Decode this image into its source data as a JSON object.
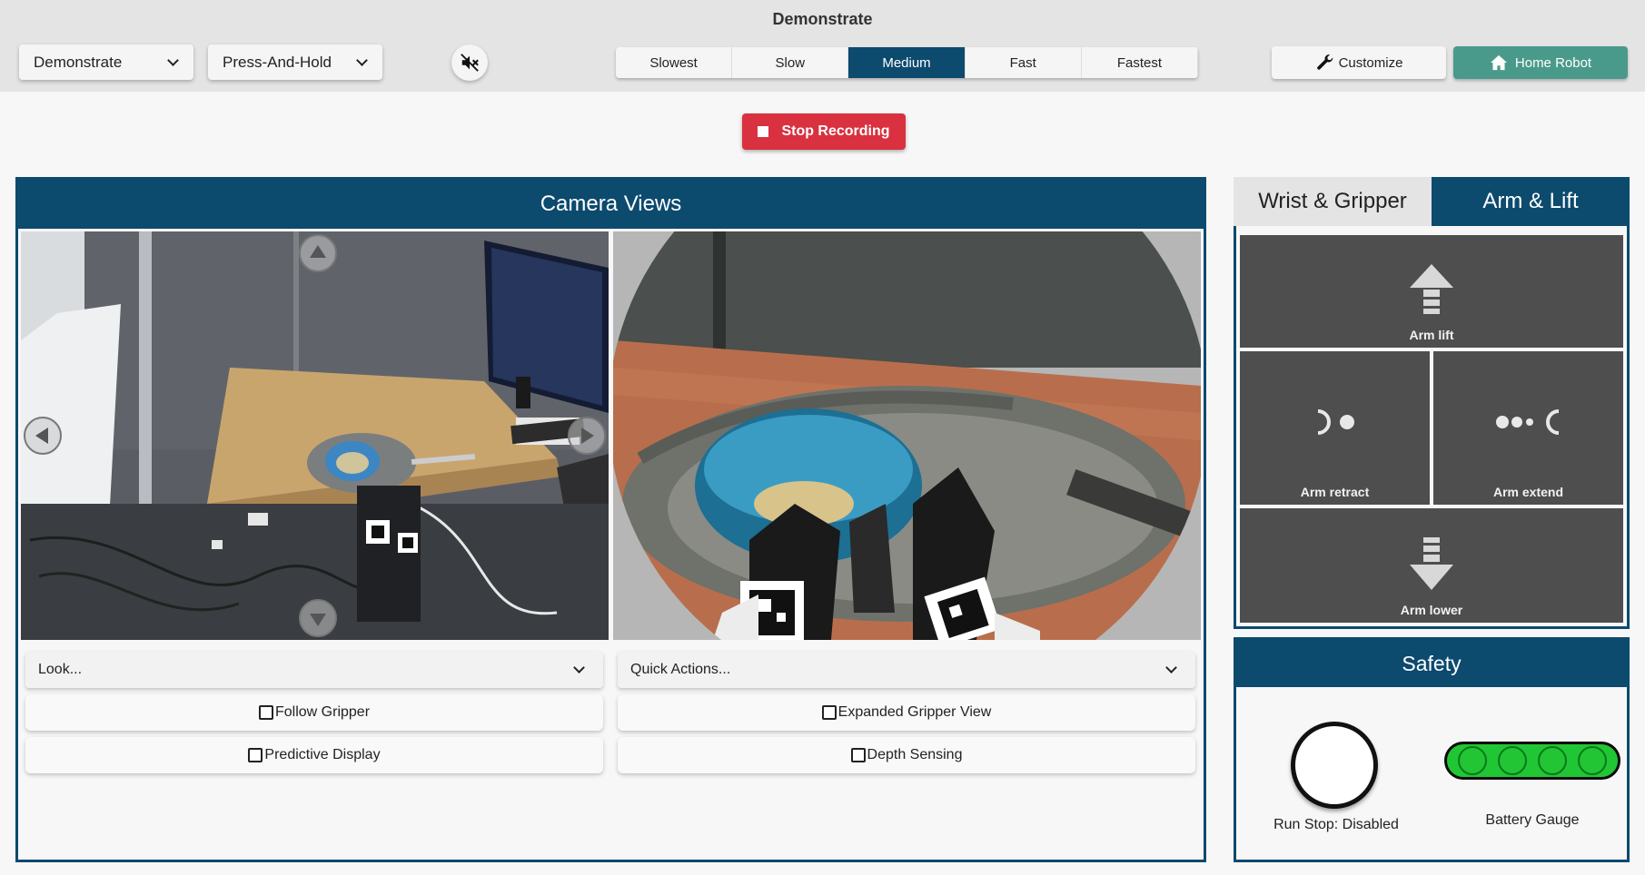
{
  "header": {
    "title": "Demonstrate",
    "mode_dropdown": "Demonstrate",
    "action_dropdown": "Press-And-Hold",
    "speeds": [
      "Slowest",
      "Slow",
      "Medium",
      "Fast",
      "Fastest"
    ],
    "active_speed": "Medium",
    "customize_label": "Customize",
    "home_label": "Home Robot"
  },
  "recording": {
    "stop_label": "Stop Recording"
  },
  "camera_panel": {
    "title": "Camera Views",
    "look_select": "Look...",
    "quick_actions_select": "Quick Actions...",
    "follow_gripper": "Follow Gripper",
    "predictive_display": "Predictive Display",
    "expanded_gripper": "Expanded Gripper View",
    "depth_sensing": "Depth Sensing"
  },
  "control_panel": {
    "tabs": [
      "Wrist & Gripper",
      "Arm & Lift"
    ],
    "active_tab": "Arm & Lift",
    "buttons": {
      "arm_lift": "Arm lift",
      "arm_retract": "Arm retract",
      "arm_extend": "Arm extend",
      "arm_lower": "Arm lower"
    }
  },
  "safety": {
    "title": "Safety",
    "runstop_label": "Run Stop: Disabled",
    "battery_label": "Battery Gauge"
  },
  "colors": {
    "primary": "#0c4a6e",
    "stop": "#d9313f",
    "home": "#4a9a8c",
    "battery": "#21c634"
  }
}
